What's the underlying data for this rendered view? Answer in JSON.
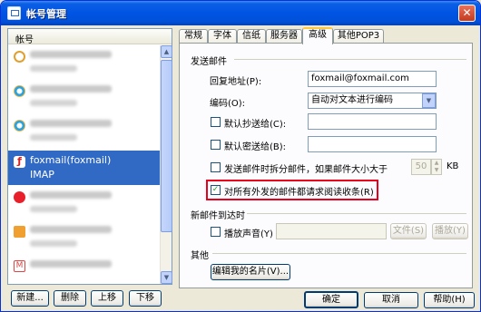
{
  "window": {
    "title": "帐号管理",
    "close": "✕"
  },
  "accounts": {
    "header": "帐号",
    "selected": {
      "name": "foxmail(foxmail)",
      "type": "IMAP"
    },
    "buttons": {
      "new": "新建...",
      "delete": "删除",
      "up": "上移",
      "down": "下移"
    }
  },
  "tabs": [
    "常规",
    "字体",
    "信纸",
    "服务器",
    "高级",
    "其他POP3"
  ],
  "active_tab": "高级",
  "send": {
    "group_title": "发送邮件",
    "reply_label": "回复地址(P):",
    "reply_value": "foxmail@foxmail.com",
    "encoding_label": "编码(O):",
    "encoding_value": "自动对文本进行编码",
    "cc_label": "默认抄送给(C):",
    "bcc_label": "默认密送给(B):",
    "split_label": "发送邮件时拆分邮件，如果邮件大小大于",
    "split_value": "50",
    "split_unit": "KB",
    "receipt_label": "对所有外发的邮件都请求阅读收条(R)"
  },
  "arrival": {
    "group_title": "新邮件到达时",
    "sound_label": "播放声音(Y)",
    "file_button": "文件(S)",
    "play_button": "播放(Y)"
  },
  "other": {
    "group_title": "其他",
    "card_button": "编辑我的名片(V)..."
  },
  "footer": {
    "ok": "确定",
    "cancel": "取消",
    "help": "帮助(H)"
  }
}
